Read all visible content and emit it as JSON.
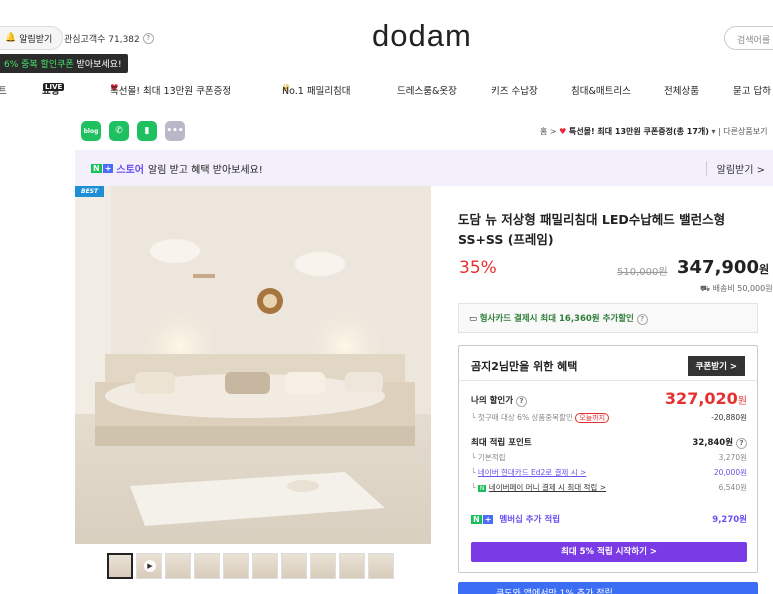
{
  "header": {
    "alarm_label": "알림받기",
    "interest_label": "관심고객수 71,382",
    "coupon_tip_green": "6% 중복 할인쿠폰",
    "coupon_tip_rest": " 받아보세요!",
    "logo": "dodam",
    "search_placeholder": "검색어를"
  },
  "nav": {
    "items": [
      "트",
      "쇼핑",
      "LIVE",
      "특선몰! 최대 13만원 쿠폰증정",
      "No.1 패밀리침대",
      "드레스룸&옷장",
      "키즈 수납장",
      "침대&매트리스",
      "전체상품",
      "묻고 답하"
    ]
  },
  "breadcrumb": {
    "home": "홈",
    "current": "특선몰! 최대 13만원 쿠폰증정(총 17개)",
    "other": "다른상품보기"
  },
  "store_banner": {
    "n_badge": "N",
    "plus_badge": "+",
    "store_name": "스토어",
    "text": "알림 받고 혜택 받아보세요!",
    "right_label": "알림받기 >"
  },
  "image": {
    "badge": "BEST"
  },
  "product": {
    "title": "도담 뉴 저상형 패밀리침대 LED수납헤드 밸런스형 SS+SS (프레임)",
    "discount": "35%",
    "original_price": "510,000원",
    "price": "347,900",
    "price_unit": "원",
    "shipping": "배송비 50,000원",
    "card_text": "형사카드 결제시 최대 16,360원 추가할인"
  },
  "benefit": {
    "title": "곰지2님만을 위한 혜택",
    "coupon_button": "쿠폰받기 >",
    "my_price_label": "나의 할인가",
    "my_price": "327,020",
    "my_price_unit": "원",
    "first_buy": "첫구매 대상 6% 상품중복할인",
    "first_buy_badge": "오늘까지",
    "first_buy_value": "-20,880원",
    "points_label": "최대 적립 포인트",
    "points_value": "32,840원",
    "basic_label": "기본적립",
    "basic_value": "3,270원",
    "naver_card": "네이버 현대카드 Ed2로 결제 시 >",
    "naver_card_value": "20,000원",
    "naverpay": "네이버페이 머니 결제 시 최대 적립 >",
    "naverpay_value": "6,540원",
    "membership_label": "멤버십 추가 적립",
    "membership_value": "9,270원",
    "membership_button": "최대 5% 적립 시작하기 >"
  },
  "bottom_bar": "쿠도와 앱에서만 1% 추가 적립"
}
